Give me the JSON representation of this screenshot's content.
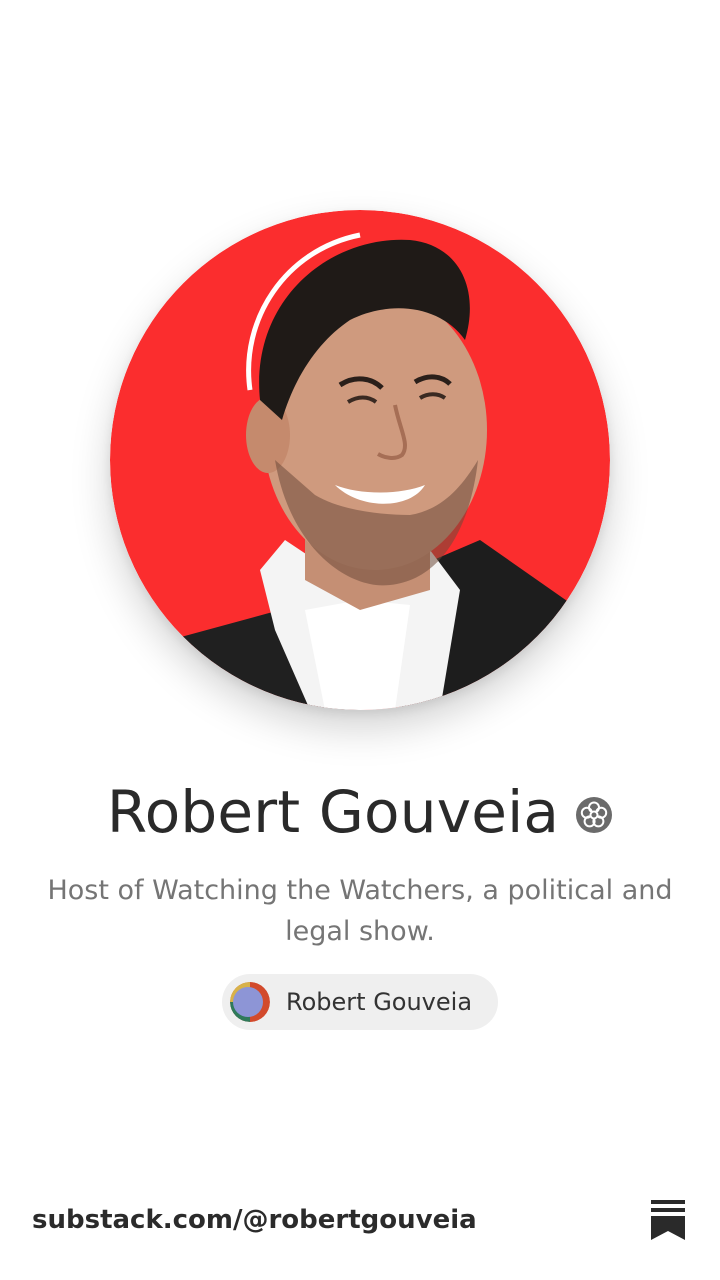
{
  "profile": {
    "name": "Robert Gouveia",
    "bio": "Host of Watching the Watchers, a political and legal show.",
    "publication_label": "Robert Gouveia",
    "avatar_alt": "Robert Gouveia",
    "badge_icon": "verified-flower-icon"
  },
  "footer": {
    "url": "substack.com/@robertgouveia",
    "logo_icon": "substack-bookmark-icon"
  },
  "colors": {
    "avatar_bg": "#fb2d2e",
    "name_text": "#2a2a2a",
    "bio_text": "#757575",
    "pill_bg": "#efefef",
    "badge": "#6b6b6b",
    "logo": "#2a2a2a"
  }
}
